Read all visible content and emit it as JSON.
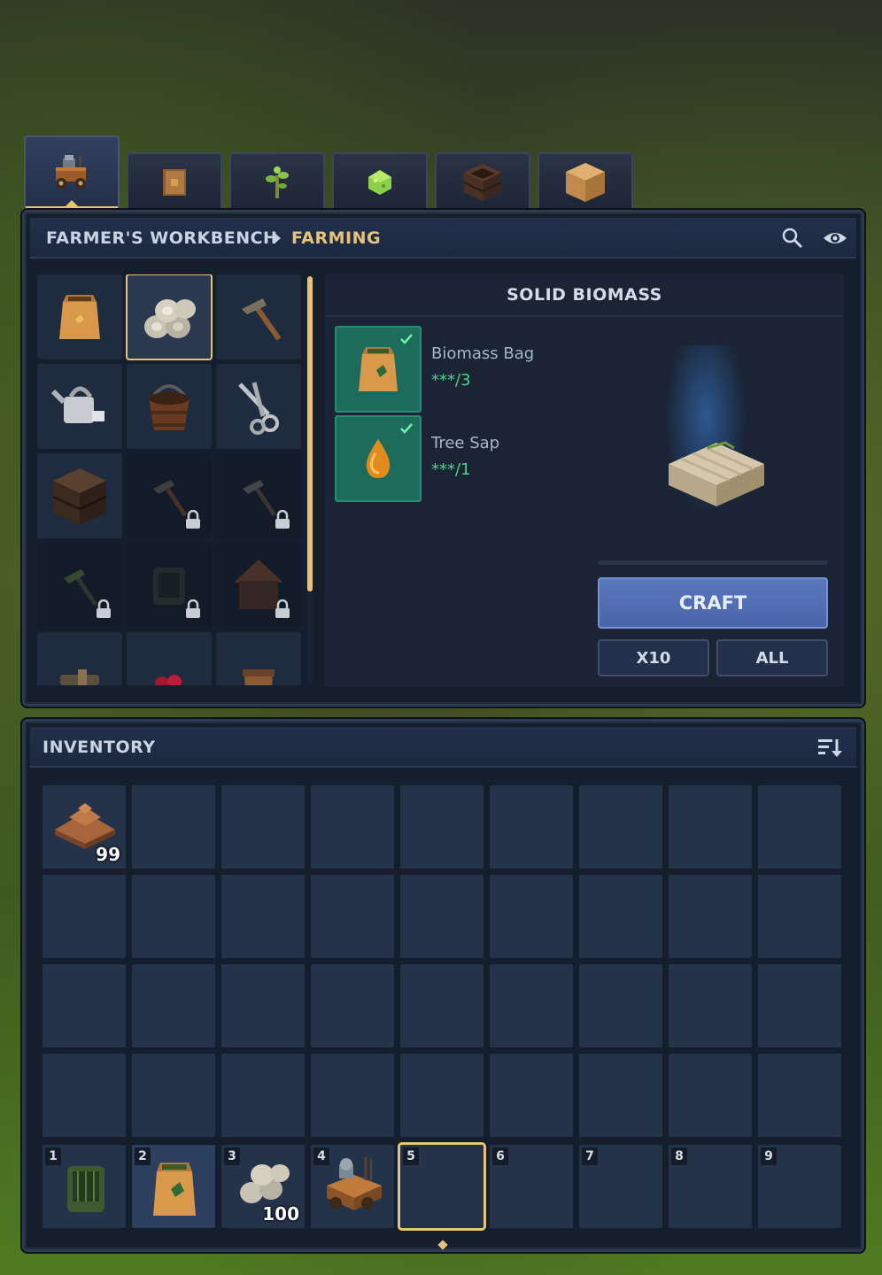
{
  "tabs": [
    {
      "icon": "workbench-cart-icon",
      "active": true
    },
    {
      "icon": "book-icon",
      "active": false
    },
    {
      "icon": "sapling-icon",
      "active": false
    },
    {
      "icon": "green-crystal-icon",
      "active": false
    },
    {
      "icon": "planter-crate-icon",
      "active": false
    },
    {
      "icon": "hay-block-icon",
      "active": false
    }
  ],
  "header": {
    "station": "FARMER'S WORKBENCH",
    "category": "FARMING",
    "search_icon": "search-icon",
    "visibility_icon": "eye-icon"
  },
  "recipes": [
    {
      "icon": "biomass-bag-icon",
      "locked": false,
      "selected": false
    },
    {
      "icon": "solid-biomass-icon",
      "locked": false,
      "selected": true
    },
    {
      "icon": "hoe-icon",
      "locked": false,
      "selected": false
    },
    {
      "icon": "watering-can-icon",
      "locked": false,
      "selected": false
    },
    {
      "icon": "bucket-icon",
      "locked": false,
      "selected": false
    },
    {
      "icon": "shears-icon",
      "locked": false,
      "selected": false
    },
    {
      "icon": "wooden-crate-icon",
      "locked": false,
      "selected": false
    },
    {
      "icon": "hoe-icon",
      "locked": true,
      "selected": false
    },
    {
      "icon": "hoe-icon",
      "locked": true,
      "selected": false
    },
    {
      "icon": "hoe-icon",
      "locked": true,
      "selected": false
    },
    {
      "icon": "composter-icon",
      "locked": true,
      "selected": false
    },
    {
      "icon": "birdhouse-icon",
      "locked": true,
      "selected": false
    },
    {
      "icon": "tool-icon",
      "locked": false,
      "selected": false
    },
    {
      "icon": "berries-icon",
      "locked": false,
      "selected": false
    },
    {
      "icon": "planter-icon",
      "locked": false,
      "selected": false
    }
  ],
  "detail": {
    "title": "SOLID BIOMASS",
    "ingredients": [
      {
        "name": "Biomass Bag",
        "qty": "***/3",
        "icon": "biomass-bag-icon",
        "check_icon": "check-icon"
      },
      {
        "name": "Tree Sap",
        "qty": "***/1",
        "icon": "tree-sap-icon",
        "check_icon": "check-icon"
      }
    ],
    "preview_icon": "solid-biomass-icon",
    "craft_label": "CRAFT",
    "x10_label": "X10",
    "all_label": "ALL"
  },
  "inventory": {
    "title": "INVENTORY",
    "sort_icon": "sort-icon",
    "first_item": {
      "icon": "dirt-pile-icon",
      "count": "99"
    },
    "hotbar": [
      {
        "num": "1",
        "icon": "composter-icon",
        "count": ""
      },
      {
        "num": "2",
        "icon": "biomass-bag-icon",
        "count": ""
      },
      {
        "num": "3",
        "icon": "solid-biomass-icon",
        "count": "100"
      },
      {
        "num": "4",
        "icon": "workbench-cart-icon",
        "count": ""
      },
      {
        "num": "5",
        "icon": "",
        "count": ""
      },
      {
        "num": "6",
        "icon": "",
        "count": ""
      },
      {
        "num": "7",
        "icon": "",
        "count": ""
      },
      {
        "num": "8",
        "icon": "",
        "count": ""
      },
      {
        "num": "9",
        "icon": "",
        "count": ""
      }
    ],
    "selected_hotbar_slot": "5"
  }
}
